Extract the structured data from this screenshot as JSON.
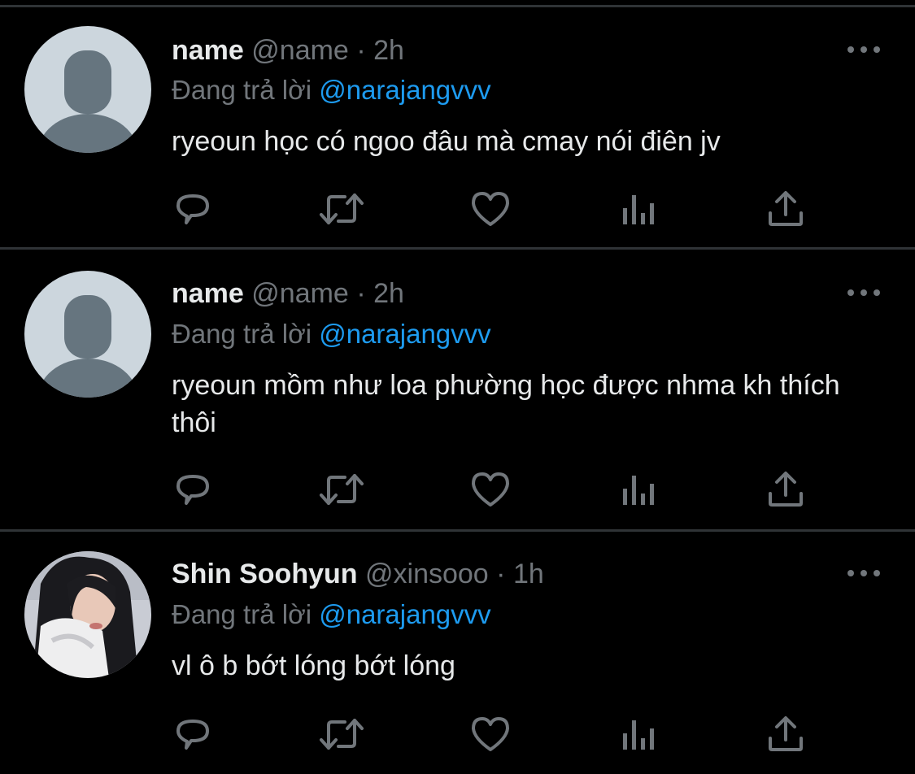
{
  "tweets": [
    {
      "name": "name",
      "handle": "@name",
      "separator": "·",
      "time": "2h",
      "replying_prefix": "Đang trả lời",
      "replying_to": "@narajangvvv",
      "text": "ryeoun học có ngoo đâu mà cmay nói điên jv",
      "avatar": "default-profile-icon"
    },
    {
      "name": "name",
      "handle": "@name",
      "separator": "·",
      "time": "2h",
      "replying_prefix": "Đang trả lời",
      "replying_to": "@narajangvvv",
      "text": "ryeoun mồm như loa phường học được nhma kh thích thôi",
      "avatar": "default-profile-icon"
    },
    {
      "name": "Shin Soohyun",
      "handle": "@xinsooo",
      "separator": "·",
      "time": "1h",
      "replying_prefix": "Đang trả lời",
      "replying_to": "@narajangvvv",
      "text": "vl ô b bớt lóng bớt lóng",
      "avatar": "profile-photo"
    }
  ],
  "actions": [
    "reply-icon",
    "retweet-icon",
    "like-icon",
    "analytics-icon",
    "share-icon"
  ],
  "colors": {
    "background": "#000000",
    "text": "#e7e9ea",
    "secondary": "#71767b",
    "accent": "#1d9bf0",
    "divider": "#2f3336",
    "avatar_bg": "#ccd6dd",
    "avatar_fg": "#66757f"
  }
}
